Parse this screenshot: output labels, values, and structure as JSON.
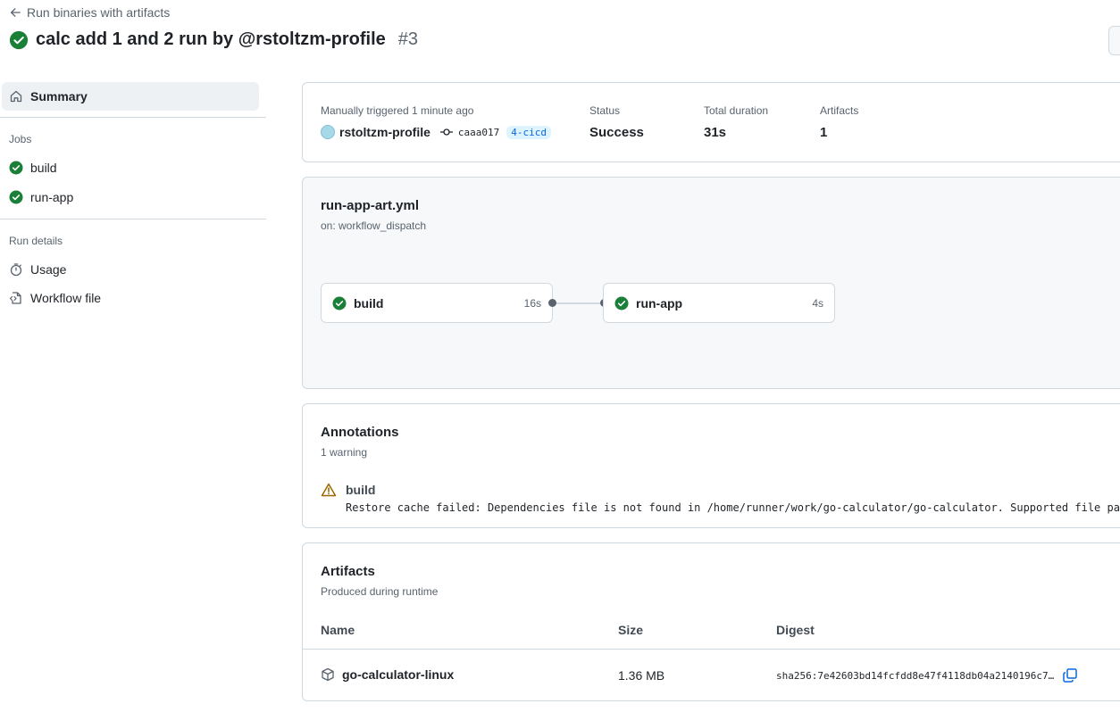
{
  "header": {
    "back_label": "Run binaries with artifacts",
    "title": "calc add 1 and 2 run by @rstoltzm-profile",
    "run_number": "#3"
  },
  "sidebar": {
    "summary_label": "Summary",
    "jobs_heading": "Jobs",
    "jobs": [
      {
        "label": "build",
        "status": "success"
      },
      {
        "label": "run-app",
        "status": "success"
      }
    ],
    "run_details_heading": "Run details",
    "details": [
      {
        "label": "Usage",
        "icon": "stopwatch-icon"
      },
      {
        "label": "Workflow file",
        "icon": "file-code-icon"
      }
    ]
  },
  "summary_card": {
    "trigger_text": "Manually triggered 1 minute ago",
    "actor": "rstoltzm-profile",
    "commit": "caaa017",
    "branch": "4-cicd",
    "status_label": "Status",
    "status_value": "Success",
    "duration_label": "Total duration",
    "duration_value": "31s",
    "artifacts_label": "Artifacts",
    "artifacts_value": "1"
  },
  "workflow": {
    "file": "run-app-art.yml",
    "trigger": "on: workflow_dispatch",
    "jobs": [
      {
        "name": "build",
        "duration": "16s",
        "status": "success"
      },
      {
        "name": "run-app",
        "duration": "4s",
        "status": "success"
      }
    ]
  },
  "annotations": {
    "title": "Annotations",
    "count_text": "1 warning",
    "items": [
      {
        "job": "build",
        "level": "warning",
        "message": "Restore cache failed: Dependencies file is not found in /home/runner/work/go-calculator/go-calculator. Supported file pattern: go.sum"
      }
    ]
  },
  "artifacts": {
    "title": "Artifacts",
    "subtitle": "Produced during runtime",
    "columns": [
      "Name",
      "Size",
      "Digest"
    ],
    "rows": [
      {
        "name": "go-calculator-linux",
        "size": "1.36 MB",
        "digest": "sha256:7e42603bd14fcfdd8e47f4118db04a2140196c7…"
      }
    ]
  },
  "colors": {
    "success": "#1a7f37",
    "warning": "#9a6700",
    "accent": "#0969da"
  }
}
